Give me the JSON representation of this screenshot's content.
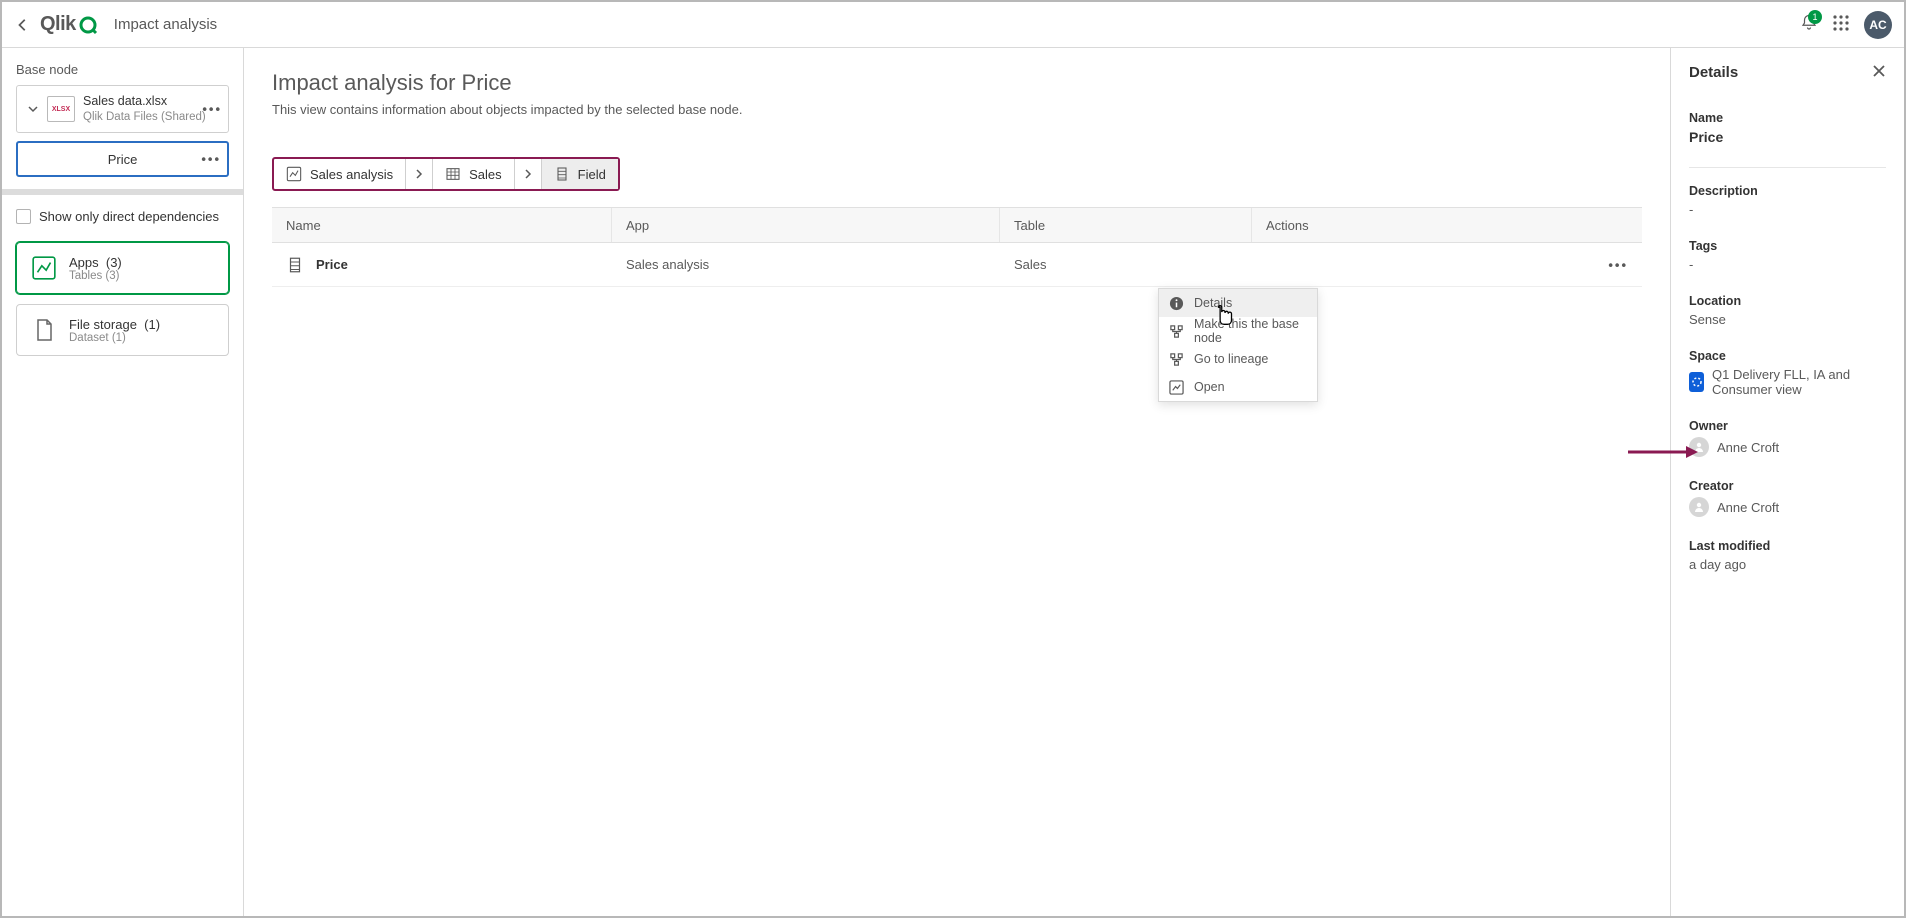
{
  "topbar": {
    "logo_text": "Qlik",
    "page_title": "Impact analysis",
    "notification_count": "1",
    "avatar_initials": "AC"
  },
  "sidebar": {
    "base_node_label": "Base node",
    "node": {
      "title": "Sales data.xlsx",
      "subtitle": "Qlik Data Files (Shared)",
      "icon_text": "XLSX"
    },
    "field": {
      "name": "Price"
    },
    "direct_deps_label": "Show only direct dependencies",
    "apps_card": {
      "title": "Apps",
      "count": "(3)",
      "subtitle": "Tables (3)"
    },
    "file_card": {
      "title": "File storage",
      "count": "(1)",
      "subtitle": "Dataset (1)"
    }
  },
  "center": {
    "heading": "Impact analysis for Price",
    "description": "This view contains information about objects impacted by the selected base node.",
    "breadcrumb": {
      "b1": "Sales analysis",
      "b2": "Sales",
      "b3": "Field"
    },
    "columns": {
      "name": "Name",
      "app": "App",
      "table": "Table",
      "actions": "Actions"
    },
    "row": {
      "name": "Price",
      "app": "Sales analysis",
      "table": "Sales"
    },
    "ctx": {
      "details": "Details",
      "make_base": "Make this the base node",
      "lineage": "Go to lineage",
      "open": "Open"
    }
  },
  "details": {
    "panel_title": "Details",
    "name_label": "Name",
    "name_value": "Price",
    "description_label": "Description",
    "description_value": "-",
    "tags_label": "Tags",
    "tags_value": "-",
    "location_label": "Location",
    "location_value": "Sense",
    "space_label": "Space",
    "space_value": "Q1 Delivery FLL, IA and Consumer view",
    "owner_label": "Owner",
    "owner_value": "Anne Croft",
    "creator_label": "Creator",
    "creator_value": "Anne Croft",
    "lastmod_label": "Last modified",
    "lastmod_value": "a day ago"
  }
}
